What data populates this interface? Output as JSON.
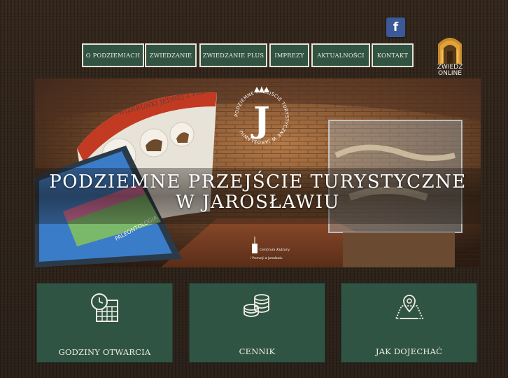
{
  "social": {
    "facebook_label": "f"
  },
  "nav": {
    "items": [
      {
        "label": "O PODZIEMIACH"
      },
      {
        "label": "ZWIEDZANIE"
      },
      {
        "label": "ZWIEDZANIE PLUS"
      },
      {
        "label": "IMPREZY"
      },
      {
        "label": "AKTUALNOŚCI"
      },
      {
        "label": "KONTAKT"
      }
    ]
  },
  "zwiedz_online": {
    "line1": "ZWIEDŹ",
    "line2": "ONLINE"
  },
  "hero": {
    "title_line1": "PODZIEMNE PRZEJŚCIE TURYSTYCZNE",
    "title_line2": "W JAROSŁAWIU",
    "emblem_letter": "J",
    "emblem_ring_text": "PODZIEMNE PRZEJŚCIE TURYSTYCZNE W JAROSŁAWIU",
    "exhibit_heading": "WIZERUNKI JEDNEJ Z PIERWSZYCH FAUNY",
    "screen_label": "PALEONTOLOGIA",
    "partner_line1": "Centrum Kultury",
    "partner_line2": "i Promocji w Jarosławiu"
  },
  "tiles": [
    {
      "label": "GODZINY OTWARCIA",
      "icon": "calendar-clock-icon"
    },
    {
      "label": "CENNIK",
      "icon": "coins-icon"
    },
    {
      "label": "JAK DOJECHAĆ",
      "icon": "map-pin-icon"
    }
  ],
  "colors": {
    "background": "#2d2219",
    "nav_bg": "#305342",
    "tile_bg": "#2f5444",
    "facebook": "#3b5998",
    "text_light": "#f3eee2"
  }
}
